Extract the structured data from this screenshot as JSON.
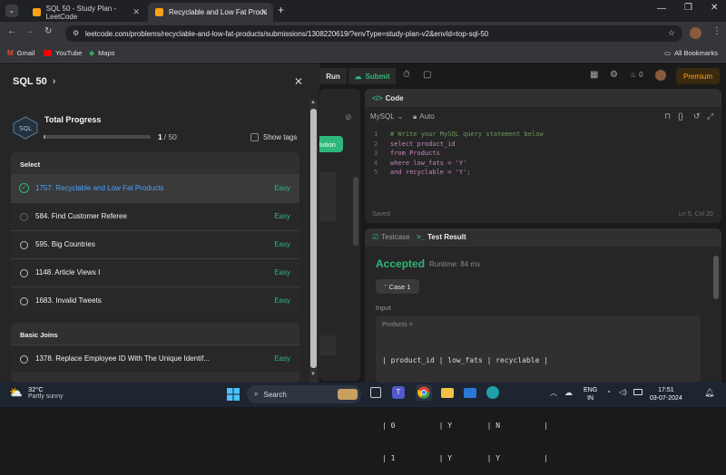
{
  "browser": {
    "tabs": [
      {
        "title": "SQL 50 - Study Plan - LeetCode",
        "active": false
      },
      {
        "title": "Recyclable and Low Fat Produc",
        "active": true
      }
    ],
    "url": "leetcode.com/problems/recyclable-and-low-fat-products/submissions/1308220619/?envType=study-plan-v2&envId=top-sql-50",
    "bookmarks": [
      "Gmail",
      "YouTube",
      "Maps"
    ],
    "all_bookmarks": "All Bookmarks"
  },
  "topbar": {
    "run": "Run",
    "submit": "Submit",
    "fire_count": "0",
    "premium": "Premium"
  },
  "panel": {
    "title": "SQL 50",
    "total_progress_label": "Total Progress",
    "progress_done": "1",
    "progress_total": "/ 50",
    "progress_fraction": 0.02,
    "show_tags": "Show tags",
    "sections": [
      {
        "title": "Select",
        "problems": [
          {
            "title": "1757. Recyclable and Low Fat Products",
            "difficulty": "Easy",
            "solved": true
          },
          {
            "title": "584. Find Customer Referee",
            "difficulty": "Easy",
            "solved": false
          },
          {
            "title": "595. Big Countries",
            "difficulty": "Easy",
            "solved": false
          },
          {
            "title": "1148. Article Views I",
            "difficulty": "Easy",
            "solved": false
          },
          {
            "title": "1683. Invalid Tweets",
            "difficulty": "Easy",
            "solved": false
          }
        ]
      },
      {
        "title": "Basic Joins",
        "problems": [
          {
            "title": "1378. Replace Employee ID With The Unique Identif...",
            "difficulty": "Easy",
            "solved": false
          }
        ]
      }
    ]
  },
  "code_panel": {
    "title": "Code",
    "language": "MySQL",
    "auto": "Auto",
    "lines": [
      {
        "n": "1",
        "text": "# Write your MySQL query statement below"
      },
      {
        "n": "2",
        "text": "select product_id"
      },
      {
        "n": "3",
        "text": "from Products"
      },
      {
        "n": "4",
        "text": "where low_fats = 'Y'"
      },
      {
        "n": "5",
        "text": "and recyclable = 'Y';"
      }
    ],
    "saved": "Saved",
    "cursor": "Ln 5, Col 20"
  },
  "result_panel": {
    "testcase_tab": "Testcase",
    "result_tab": "Test Result",
    "status": "Accepted",
    "runtime": "Runtime: 84 ms",
    "case": "Case 1",
    "input_label": "Input",
    "table_name": "Products =",
    "table_lines": [
      "| product_id | low_fats | recyclable |",
      "| ---------- | -------- | ---------- |",
      "| 0          | Y        | N          |",
      "| 1          | Y        | Y          |"
    ]
  },
  "background_peek": {
    "solution_btn": "lution"
  },
  "taskbar": {
    "weather_temp": "32°C",
    "weather_desc": "Partly sunny",
    "search": "Search",
    "lang": "ENG",
    "region": "IN",
    "time": "17:51",
    "date": "03-07-2024"
  }
}
